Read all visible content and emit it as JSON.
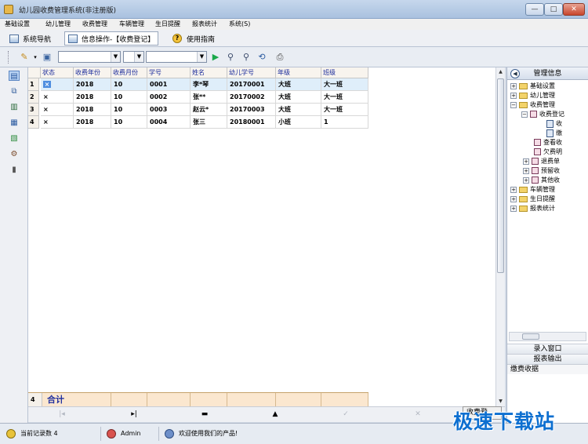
{
  "window": {
    "title": "幼儿园收费管理系统(非注册版)",
    "min": "—",
    "max": "□",
    "close": "✕"
  },
  "menu": [
    "基础设置",
    "幼儿管理",
    "收费管理",
    "车辆管理",
    "生日提醒",
    "报表统计",
    "系统(S)"
  ],
  "nav": {
    "system_nav": "系统导航",
    "info_tab": "信息操作-【收费登记】",
    "help": "使用指南"
  },
  "toolbar": {
    "combo1": "",
    "combo2": "",
    "combo3": ""
  },
  "grid": {
    "columns": [
      "状态",
      "收费年份",
      "收费月份",
      "学号",
      "姓名",
      "幼儿学号",
      "年级",
      "班级"
    ],
    "rows": [
      {
        "num": "1",
        "status": "×",
        "year": "2018",
        "month": "10",
        "sid": "0001",
        "name": "李*琴",
        "child_id": "20170001",
        "grade": "大班",
        "class": "大一班"
      },
      {
        "num": "2",
        "status": "×",
        "year": "2018",
        "month": "10",
        "sid": "0002",
        "name": "张**",
        "child_id": "20170002",
        "grade": "大班",
        "class": "大一班"
      },
      {
        "num": "3",
        "status": "×",
        "year": "2018",
        "month": "10",
        "sid": "0003",
        "name": "赵云*",
        "child_id": "20170003",
        "grade": "大班",
        "class": "大一班"
      },
      {
        "num": "4",
        "status": "×",
        "year": "2018",
        "month": "10",
        "sid": "0004",
        "name": "张三",
        "child_id": "20180001",
        "grade": "小班",
        "class": "1"
      }
    ],
    "footer_count": "4",
    "footer_label": "合计"
  },
  "right_panel": {
    "title": "管理信息",
    "tree": [
      "基础设置",
      "幼儿管理",
      "收费管理",
      "收费登记",
      "收",
      "缴",
      "查看收",
      "欠费明",
      "退费单",
      "预留收",
      "其他收",
      "车辆管理",
      "生日提醒",
      "报表统计"
    ],
    "buttons": [
      "录入窗口",
      "报表输出"
    ],
    "current": "缴费收据"
  },
  "status": {
    "records": "当前记录数 4",
    "user": "Admin",
    "welcome": "欢迎使用我们的产品!"
  },
  "watermark": "极速下载站",
  "bottom_button": "收费登"
}
